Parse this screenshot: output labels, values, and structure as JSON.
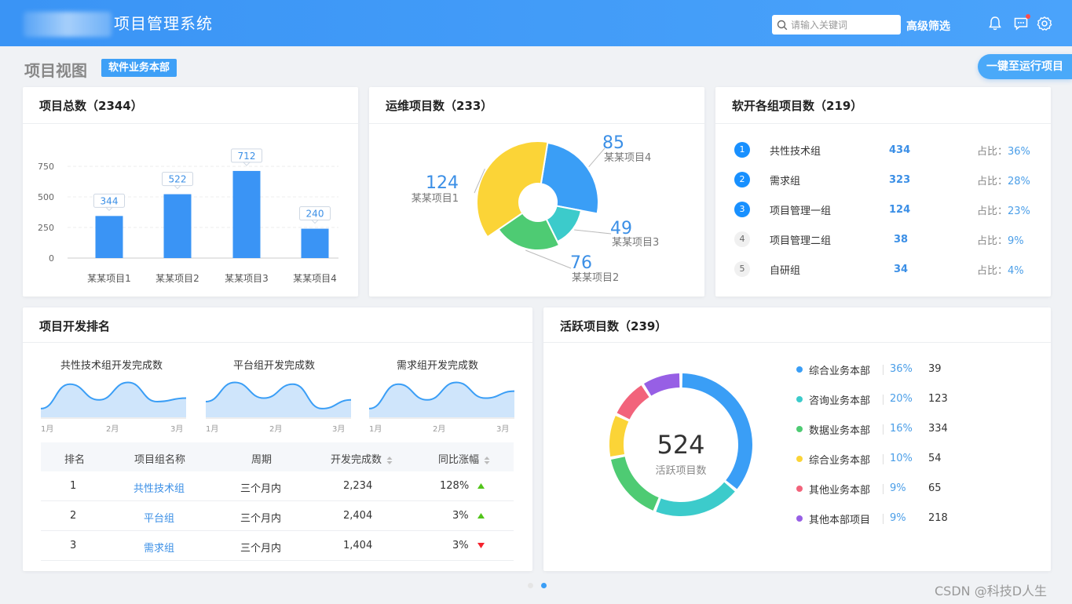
{
  "header": {
    "app_title": "项目管理系统",
    "search_placeholder": "请输入关键词",
    "advanced_filter": "高级筛选",
    "colors": {
      "header_start": "#3a94f5",
      "header_end": "#4aa3fb"
    }
  },
  "page": {
    "title": "项目视图",
    "dept_tag": "软件业务本部",
    "run_button": "一键至运行项目"
  },
  "total_projects": {
    "title": "项目总数（2344）",
    "chart_data": {
      "type": "bar",
      "categories": [
        "某某项目1",
        "某某项目2",
        "某某项目3",
        "某某项目4"
      ],
      "values": [
        344,
        522,
        712,
        240
      ],
      "yticks": [
        0,
        250,
        500,
        750
      ],
      "ylim": [
        0,
        900
      ],
      "color": "#3a94f5"
    }
  },
  "ops_projects": {
    "title": "运维项目数（233）",
    "chart_data": {
      "type": "pie",
      "labels": [
        "某某项目4",
        "某某项目3",
        "某某项目2",
        "某某项目1"
      ],
      "values": [
        85,
        49,
        76,
        124
      ],
      "colors": [
        "#3a9ef6",
        "#3ccbcb",
        "#4ecb73",
        "#fbd437"
      ]
    }
  },
  "group_projects": {
    "title": "软开各组项目数（219）",
    "ratio_label": "占比：",
    "rows": [
      {
        "rank": "1",
        "name": "共性技术组",
        "count": "434",
        "ratio": "36%"
      },
      {
        "rank": "2",
        "name": "需求组",
        "count": "323",
        "ratio": "28%"
      },
      {
        "rank": "3",
        "name": "项目管理一组",
        "count": "124",
        "ratio": "23%"
      },
      {
        "rank": "4",
        "name": "项目管理二组",
        "count": "38",
        "ratio": "9%"
      },
      {
        "rank": "5",
        "name": "自研组",
        "count": "34",
        "ratio": "4%"
      }
    ]
  },
  "dev_ranking": {
    "title": "项目开发排名",
    "sparklines": [
      {
        "title": "共性技术组开发完成数",
        "ticks": [
          "1月",
          "2月",
          "3月"
        ],
        "values": [
          10,
          38,
          20,
          40,
          18,
          22
        ]
      },
      {
        "title": "平台组开发完成数",
        "ticks": [
          "1月",
          "2月",
          "3月"
        ],
        "values": [
          18,
          40,
          22,
          38,
          10,
          20
        ]
      },
      {
        "title": "需求组开发完成数",
        "ticks": [
          "1月",
          "2月",
          "3月"
        ],
        "values": [
          10,
          38,
          20,
          40,
          22,
          30
        ]
      }
    ],
    "table": {
      "headers": [
        "排名",
        "项目组名称",
        "周期",
        "开发完成数",
        "同比涨幅"
      ],
      "rows": [
        {
          "rank": "1",
          "name": "共性技术组",
          "period": "三个月内",
          "done": "2,234",
          "growth": "128%",
          "trend": "up"
        },
        {
          "rank": "2",
          "name": "平台组",
          "period": "三个月内",
          "done": "2,404",
          "growth": "3%",
          "trend": "up"
        },
        {
          "rank": "3",
          "name": "需求组",
          "period": "三个月内",
          "done": "1,404",
          "growth": "3%",
          "trend": "down"
        }
      ]
    }
  },
  "active_projects": {
    "title": "活跃项目数（239）",
    "center_value": "524",
    "center_label": "活跃项目数",
    "chart_data": {
      "type": "pie",
      "labels": [
        "综合业务本部",
        "咨询业务本部",
        "数据业务本部",
        "综合业务本部",
        "其他业务本部",
        "其他本部项目"
      ],
      "percents": [
        36,
        20,
        16,
        10,
        9,
        9
      ],
      "values": [
        39,
        123,
        334,
        54,
        65,
        218
      ],
      "colors": [
        "#3a9ef6",
        "#3ccbcb",
        "#4ecb73",
        "#fbd437",
        "#f2637b",
        "#975fe5"
      ]
    },
    "legend": [
      {
        "name": "综合业务本部",
        "pct": "36%",
        "val": "39"
      },
      {
        "name": "咨询业务本部",
        "pct": "20%",
        "val": "123"
      },
      {
        "name": "数据业务本部",
        "pct": "16%",
        "val": "334"
      },
      {
        "name": "综合业务本部",
        "pct": "10%",
        "val": "54"
      },
      {
        "name": "其他业务本部",
        "pct": "9%",
        "val": "65"
      },
      {
        "name": "其他本部项目",
        "pct": "9%",
        "val": "218"
      }
    ]
  },
  "watermark": "CSDN @科技D人生"
}
